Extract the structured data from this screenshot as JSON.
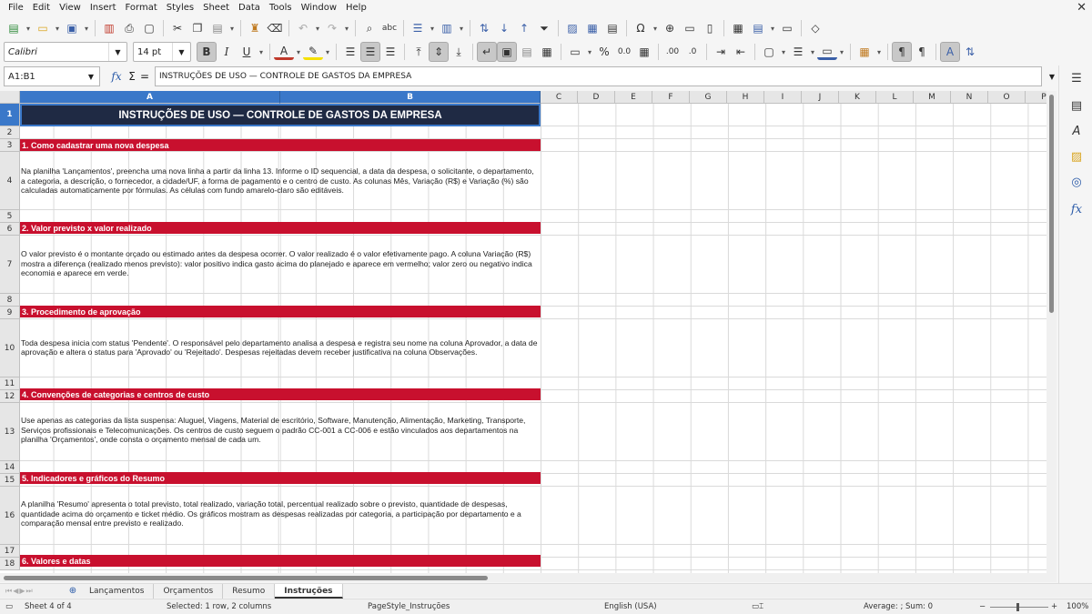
{
  "menu": [
    "File",
    "Edit",
    "View",
    "Insert",
    "Format",
    "Styles",
    "Sheet",
    "Data",
    "Tools",
    "Window",
    "Help"
  ],
  "toolbar": {
    "font_name": "Calibri",
    "font_size": "14 pt",
    "bold": "B",
    "italic": "I",
    "underline": "U",
    "percent": "%",
    "decimal": "0.0",
    "add_decimal": ".00",
    "remove_decimal": ".0"
  },
  "formula_bar": {
    "name_box": "A1:B1",
    "fx": "fx",
    "sum": "Σ",
    "equals": "=",
    "content": "INSTRUÇÕES DE USO — CONTROLE DE GASTOS DA EMPRESA"
  },
  "columns": [
    "A",
    "B",
    "C",
    "D",
    "E",
    "F",
    "G",
    "H",
    "I",
    "J",
    "K",
    "L",
    "M",
    "N",
    "O",
    "P"
  ],
  "rows": [
    "1",
    "2",
    "3",
    "4",
    "5",
    "6",
    "7",
    "8",
    "9",
    "10",
    "11",
    "12",
    "13",
    "14",
    "15",
    "16",
    "17",
    "18"
  ],
  "cells": {
    "title": "INSTRUÇÕES DE USO — CONTROLE DE GASTOS DA EMPRESA",
    "s1_heading": "1. Como cadastrar uma nova despesa",
    "s1_body": "Na planilha 'Lançamentos', preencha uma nova linha a partir da linha 13. Informe o ID sequencial, a data da despesa, o solicitante, o departamento, a categoria, a descrição, o fornecedor, a cidade/UF, a forma de pagamento e o centro de custo. As colunas Mês, Variação (R$) e Variação (%) são calculadas automaticamente por fórmulas. As células com fundo amarelo-claro são editáveis.",
    "s2_heading": "2. Valor previsto x valor realizado",
    "s2_body": "O valor previsto é o montante orçado ou estimado antes da despesa ocorrer. O valor realizado é o valor efetivamente pago. A coluna Variação (R$) mostra a diferença (realizado menos previsto): valor positivo indica gasto acima do planejado e aparece em vermelho; valor zero ou negativo indica economia e aparece em verde.",
    "s3_heading": "3. Procedimento de aprovação",
    "s3_body": "Toda despesa inicia com status 'Pendente'. O responsável pelo departamento analisa a despesa e registra seu nome na coluna Aprovador, a data de aprovação e altera o status para 'Aprovado' ou 'Rejeitado'. Despesas rejeitadas devem receber justificativa na coluna Observações.",
    "s4_heading": "4. Convenções de categorias e centros de custo",
    "s4_body": "Use apenas as categorias da lista suspensa: Aluguel, Viagens, Material de escritório, Software, Manutenção, Alimentação, Marketing, Transporte, Serviços profissionais e Telecomunicações. Os centros de custo seguem o padrão CC-001 a CC-006 e estão vinculados aos departamentos na planilha 'Orçamentos', onde consta o orçamento mensal de cada um.",
    "s5_heading": "5. Indicadores e gráficos do Resumo",
    "s5_body": "A planilha 'Resumo' apresenta o total previsto, total realizado, variação total, percentual realizado sobre o previsto, quantidade de despesas, quantidade acima do orçamento e ticket médio. Os gráficos mostram as despesas realizadas por categoria, a participação por departamento e a comparação mensal entre previsto e realizado.",
    "s6_heading": "6. Valores e datas"
  },
  "sheets": [
    "Lançamentos",
    "Orçamentos",
    "Resumo",
    "Instruções"
  ],
  "active_sheet": "Instruções",
  "status": {
    "sheet_pos": "Sheet 4 of 4",
    "selection": "Selected: 1 row, 2 columns",
    "page_style": "PageStyle_Instruções",
    "language": "English (USA)",
    "sum": "Average: ; Sum: 0",
    "zoom": "100%",
    "zoom_minus": "−",
    "zoom_plus": "+"
  },
  "colors": {
    "title_bg": "#1f2a44",
    "section_bg": "#c8102e",
    "selection": "#3a78c9"
  },
  "icons": {
    "sidebar": [
      "properties-icon",
      "styles-icon",
      "gallery-icon",
      "navigator-icon",
      "functions-icon"
    ]
  }
}
